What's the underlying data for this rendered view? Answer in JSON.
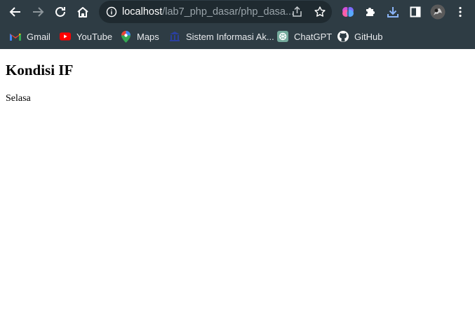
{
  "browser": {
    "url_host": "localhost",
    "url_path": "/lab7_php_dasar/php_dasa...",
    "bookmarks": [
      {
        "label": "Gmail",
        "icon": "gmail-icon"
      },
      {
        "label": "YouTube",
        "icon": "youtube-icon"
      },
      {
        "label": "Maps",
        "icon": "maps-icon"
      },
      {
        "label": "Sistem Informasi Ak...",
        "icon": "university-icon"
      },
      {
        "label": "ChatGPT",
        "icon": "chatgpt-icon"
      },
      {
        "label": "GitHub",
        "icon": "github-icon"
      }
    ],
    "colors": {
      "chrome": "#2e3c44",
      "omnibox": "#1f2a30"
    }
  },
  "page": {
    "heading": "Kondisi IF",
    "text": "Selasa"
  }
}
